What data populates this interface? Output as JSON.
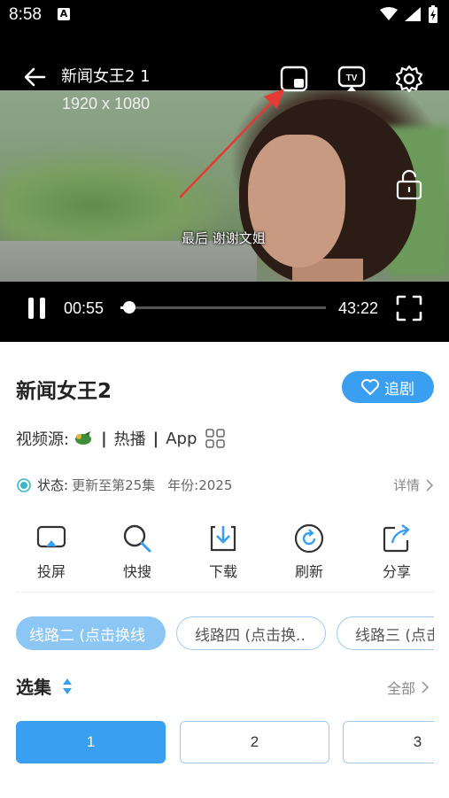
{
  "status_bar": {
    "time": "8:58",
    "notif_label": "A"
  },
  "player": {
    "title": "新闻女王2 1",
    "resolution": "1920 x 1080",
    "subtitle": "最后 谢谢文姐",
    "current_time": "00:55",
    "total_time": "43:22",
    "progress": 0.02
  },
  "show": {
    "title": "新闻女王2",
    "follow_label": "追剧",
    "source_label": "视频源:",
    "source_items": [
      "热播",
      "App"
    ],
    "status_label": "状态:",
    "status_value": "更新至第25集",
    "year_label": "年份:",
    "year_value": "2025",
    "details_label": "详情"
  },
  "actions": [
    {
      "label": "投屏",
      "icon": "cast-icon"
    },
    {
      "label": "快搜",
      "icon": "search-icon"
    },
    {
      "label": "下载",
      "icon": "download-icon"
    },
    {
      "label": "刷新",
      "icon": "refresh-icon"
    },
    {
      "label": "分享",
      "icon": "share-icon"
    }
  ],
  "lines": [
    {
      "label": "线路二 (点击换线",
      "active": true
    },
    {
      "label": "线路四 (点击换..",
      "active": false
    },
    {
      "label": "线路三 (点击",
      "active": false
    }
  ],
  "episodes_section": {
    "title": "选集",
    "all_label": "全部"
  },
  "episodes": [
    {
      "label": "1",
      "active": true
    },
    {
      "label": "2",
      "active": false
    },
    {
      "label": "3",
      "active": false
    }
  ],
  "colors": {
    "accent": "#3a9ff0",
    "pill_active": "#8cc6f4",
    "annotation_arrow": "#e53935"
  }
}
